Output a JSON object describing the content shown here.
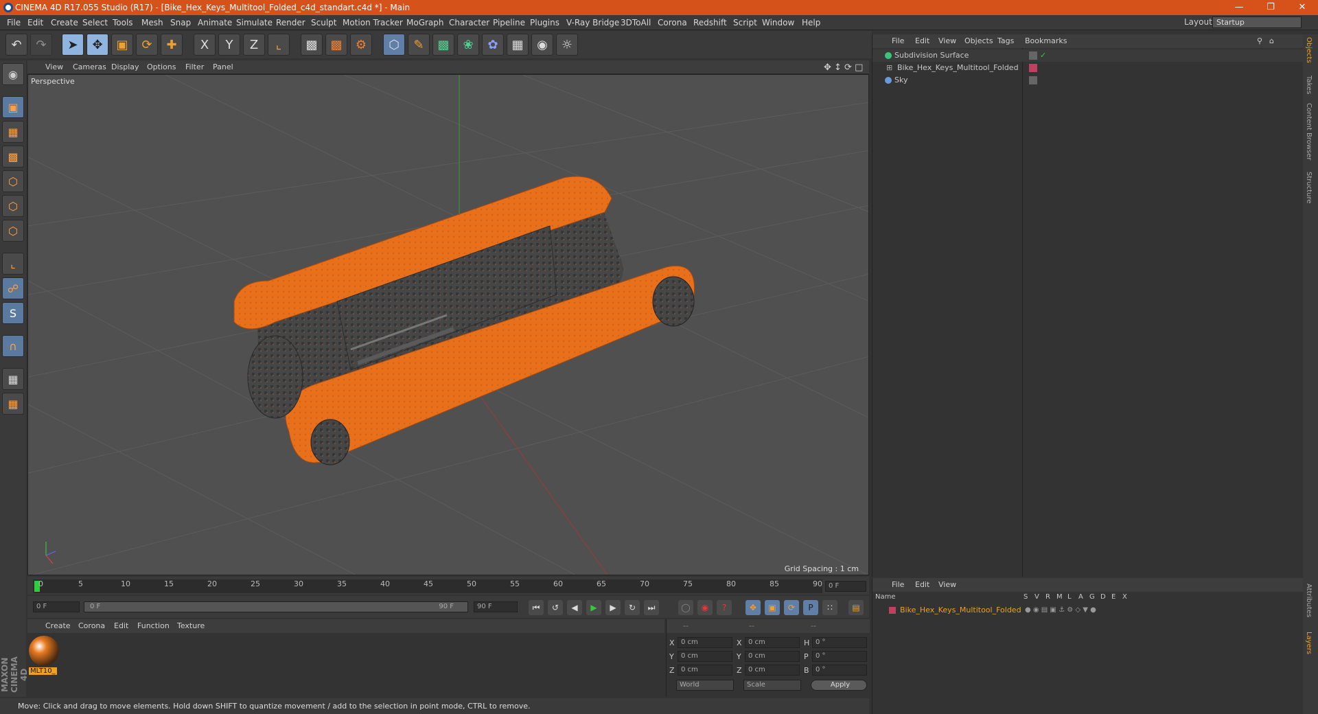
{
  "window": {
    "title": "CINEMA 4D R17.055 Studio (R17) - [Bike_Hex_Keys_Multitool_Folded_c4d_standart.c4d *] - Main"
  },
  "menu": [
    "File",
    "Edit",
    "Create",
    "Select",
    "Tools",
    "Mesh",
    "Snap",
    "Animate",
    "Simulate",
    "Render",
    "Sculpt",
    "Motion Tracker",
    "MoGraph",
    "Character",
    "Pipeline",
    "Plugins",
    "V-Ray Bridge",
    "3DToAll",
    "Corona",
    "Redshift",
    "Script",
    "Window",
    "Help"
  ],
  "layout": {
    "label": "Layout:",
    "value": "Startup"
  },
  "toolbar": {
    "x": "X",
    "y": "Y",
    "z": "Z"
  },
  "viewport": {
    "menu": [
      "View",
      "Cameras",
      "Display",
      "Options",
      "Filter",
      "Panel"
    ],
    "label": "Perspective",
    "grid_spacing": "Grid Spacing : 1 cm"
  },
  "timeline": {
    "ticks": [
      "0",
      "5",
      "10",
      "15",
      "20",
      "25",
      "30",
      "35",
      "40",
      "45",
      "50",
      "55",
      "60",
      "65",
      "70",
      "75",
      "80",
      "85",
      "90"
    ],
    "current_frame": "0 F",
    "start": "0 F",
    "range_start": "0 F",
    "range_end": "90 F",
    "end": "90 F"
  },
  "material": {
    "menu": [
      "Create",
      "Corona",
      "Edit",
      "Function",
      "Texture"
    ],
    "name": "MLT10_"
  },
  "coords": {
    "header": [
      "--",
      "--",
      "--"
    ],
    "rows": [
      {
        "a": "X",
        "v1": "0 cm",
        "b": "X",
        "v2": "0 cm",
        "c": "H",
        "v3": "0 °"
      },
      {
        "a": "Y",
        "v1": "0 cm",
        "b": "Y",
        "v2": "0 cm",
        "c": "P",
        "v3": "0 °"
      },
      {
        "a": "Z",
        "v1": "0 cm",
        "b": "Z",
        "v2": "0 cm",
        "c": "B",
        "v3": "0 °"
      }
    ],
    "world": "World",
    "scale": "Scale",
    "apply": "Apply"
  },
  "status": "Move: Click and drag to move elements. Hold down SHIFT to quantize movement / add to the selection in point mode, CTRL to remove.",
  "objects": {
    "menu": [
      "File",
      "Edit",
      "View",
      "Objects",
      "Tags",
      "Bookmarks"
    ],
    "items": [
      {
        "name": "Subdivision Surface",
        "color": "#3cc47c"
      },
      {
        "name": "Bike_Hex_Keys_Multitool_Folded",
        "color": "#c04060"
      },
      {
        "name": "Sky",
        "color": "#6a9ad8"
      }
    ]
  },
  "layers": {
    "menu": [
      "File",
      "Edit",
      "View"
    ],
    "name_header": "Name",
    "flags": [
      "S",
      "V",
      "R",
      "M",
      "L",
      "A",
      "G",
      "D",
      "E",
      "X"
    ],
    "row": "Bike_Hex_Keys_Multitool_Folded",
    "row_color": "#c04060"
  },
  "right_tabs": [
    "Objects",
    "Takes",
    "Content Browser",
    "Structure",
    "Attributes",
    "Layers"
  ],
  "maxon": "MAXON CINEMA 4D"
}
